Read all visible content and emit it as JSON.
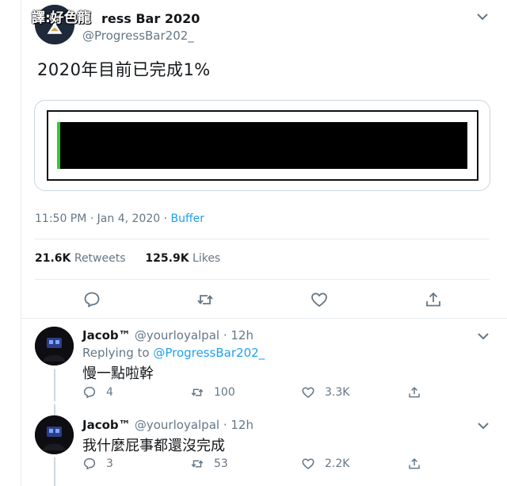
{
  "header": {
    "watermark": "譯:好色龍",
    "display_name": "ress Bar 2020",
    "handle": "@ProgressBar202_"
  },
  "tweet": {
    "text": "2020年目前已完成1%",
    "progress": 0.01,
    "time": "11:50 PM · Jan 4, 2020 ·",
    "source": "Buffer",
    "retweets_count": "21.6K",
    "retweets_label": "Retweets",
    "likes_count": "125.9K",
    "likes_label": "Likes"
  },
  "replies": [
    {
      "name": "Jacob™",
      "handle": "@yourloyalpal · 12h",
      "replying_prefix": "Replying to",
      "replying_to": "@ProgressBar202_",
      "text": "慢一點啦幹",
      "comments": "4",
      "retweets": "100",
      "likes": "3.3K"
    },
    {
      "name": "Jacob™",
      "handle": "@yourloyalpal · 12h",
      "text": "我什麼屁事都還沒完成",
      "comments": "3",
      "retweets": "53",
      "likes": "2.2K"
    }
  ],
  "colors": {
    "accent": "#1da1f2",
    "progress_fill": "#2ecc2e",
    "progress_track": "#000000",
    "muted": "#657786"
  },
  "icons": [
    "chevron-down-icon",
    "comment-icon",
    "retweet-icon",
    "heart-icon",
    "share-icon"
  ]
}
